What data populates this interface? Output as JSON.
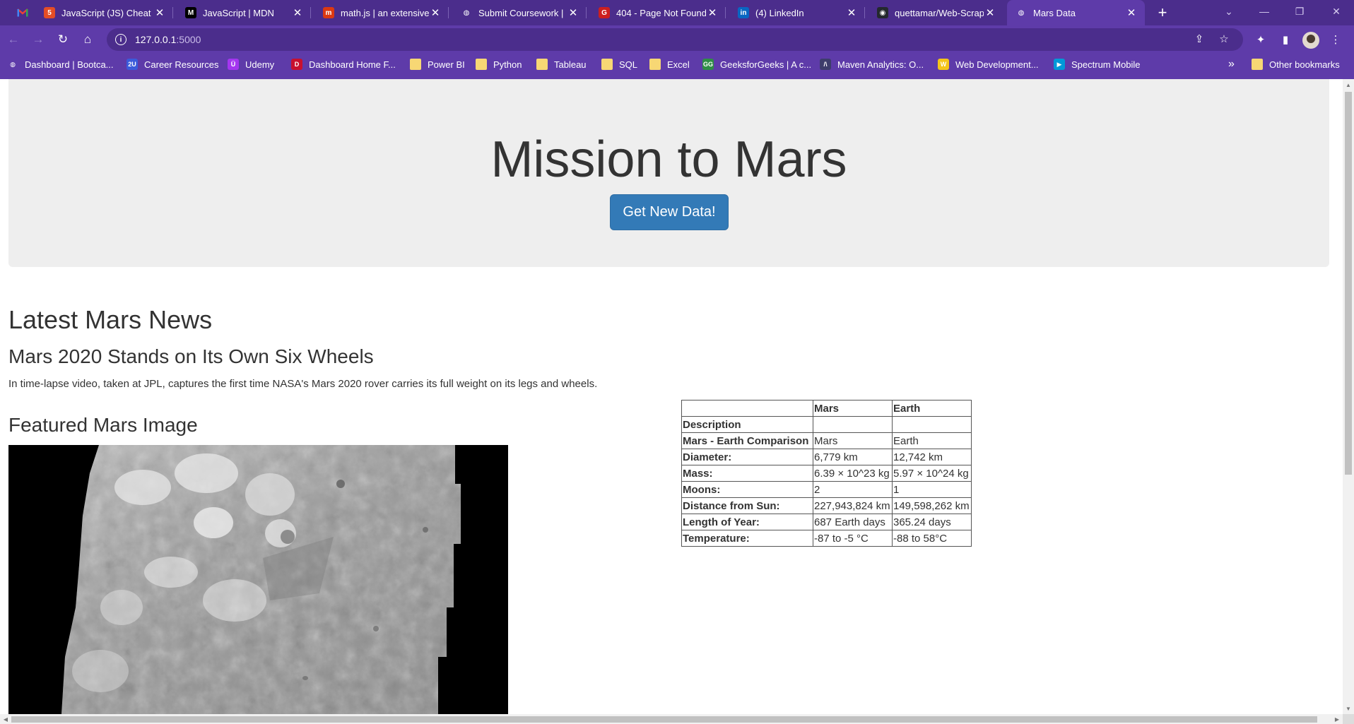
{
  "browser": {
    "tabs": [
      {
        "title": "JavaScript (JS) Cheat Sheet",
        "icon": "html5-icon",
        "color": "#e44d26",
        "glyph": "5"
      },
      {
        "title": "JavaScript | MDN",
        "icon": "mdn-icon",
        "color": "#000000",
        "glyph": "M"
      },
      {
        "title": "math.js | an extensive math library",
        "icon": "mathjs-icon",
        "color": "#dc3912",
        "glyph": "m"
      },
      {
        "title": "Submit Coursework | Bootcamp",
        "icon": "globe-icon",
        "color": "#ffffff",
        "glyph": "◍"
      },
      {
        "title": "404 - Page Not Found",
        "icon": "error-page-icon",
        "color": "#cc1f1f",
        "glyph": "G"
      },
      {
        "title": "(4) LinkedIn",
        "icon": "linkedin-icon",
        "color": "#0a66c2",
        "glyph": "in"
      },
      {
        "title": "quettamar/Web-Scraping",
        "icon": "github-icon",
        "color": "#24292e",
        "glyph": "◉"
      },
      {
        "title": "Mars Data",
        "icon": "globe-icon",
        "color": "#ffffff",
        "glyph": "◍"
      }
    ],
    "gmail_icon": "gmail-icon",
    "url_host": "127.0.0.1",
    "url_port": ":5000",
    "bookmarks": [
      {
        "label": "Dashboard | Bootca...",
        "icon": "globe-icon",
        "color": "#ffffff",
        "glyph": "◍"
      },
      {
        "label": "Career Resources",
        "icon": "2u-icon",
        "color": "#3b5bdb",
        "glyph": "2U"
      },
      {
        "label": "Udemy",
        "icon": "udemy-icon",
        "color": "#a435f0",
        "glyph": "Ü"
      },
      {
        "label": "Dashboard Home F...",
        "icon": "dashboard-icon",
        "color": "#c8102e",
        "glyph": "D"
      },
      {
        "label": "Power BI",
        "icon": "folder-icon",
        "color": "#f7d774",
        "glyph": ""
      },
      {
        "label": "Python",
        "icon": "folder-icon",
        "color": "#f7d774",
        "glyph": ""
      },
      {
        "label": "Tableau",
        "icon": "folder-icon",
        "color": "#f7d774",
        "glyph": ""
      },
      {
        "label": "SQL",
        "icon": "folder-icon",
        "color": "#f7d774",
        "glyph": ""
      },
      {
        "label": "Excel",
        "icon": "folder-icon",
        "color": "#f7d774",
        "glyph": ""
      },
      {
        "label": "GeeksforGeeks | A c...",
        "icon": "geeksforgeeks-icon",
        "color": "#2f8d46",
        "glyph": "GG"
      },
      {
        "label": "Maven Analytics: O...",
        "icon": "maven-icon",
        "color": "#3d3d6b",
        "glyph": "/\\"
      },
      {
        "label": "Web Development...",
        "icon": "webdev-icon",
        "color": "#f5c518",
        "glyph": "W"
      },
      {
        "label": "Spectrum Mobile",
        "icon": "spectrum-icon",
        "color": "#0099d8",
        "glyph": "▶"
      }
    ],
    "more_bookmarks": "»",
    "other_bookmarks": "Other bookmarks"
  },
  "page": {
    "title": "Mission to Mars",
    "button": "Get New Data!",
    "news_header": "Latest Mars News",
    "news_title": "Mars 2020 Stands on Its Own Six Wheels",
    "news_paragraph": "In time-lapse video, taken at JPL, captures the first time NASA's Mars 2020 rover carries its full weight on its legs and wheels.",
    "image_header": "Featured Mars Image",
    "facts": {
      "headers": [
        "",
        "Mars",
        "Earth"
      ],
      "rows": [
        [
          "Description",
          "",
          ""
        ],
        [
          "Mars - Earth Comparison",
          "Mars",
          "Earth"
        ],
        [
          "Diameter:",
          "6,779 km",
          "12,742 km"
        ],
        [
          "Mass:",
          "6.39 × 10^23 kg",
          "5.97 × 10^24 kg"
        ],
        [
          "Moons:",
          "2",
          "1"
        ],
        [
          "Distance from Sun:",
          "227,943,824 km",
          "149,598,262 km"
        ],
        [
          "Length of Year:",
          "687 Earth days",
          "365.24 days"
        ],
        [
          "Temperature:",
          "-87 to -5 °C",
          "-88 to 58°C"
        ]
      ]
    }
  }
}
